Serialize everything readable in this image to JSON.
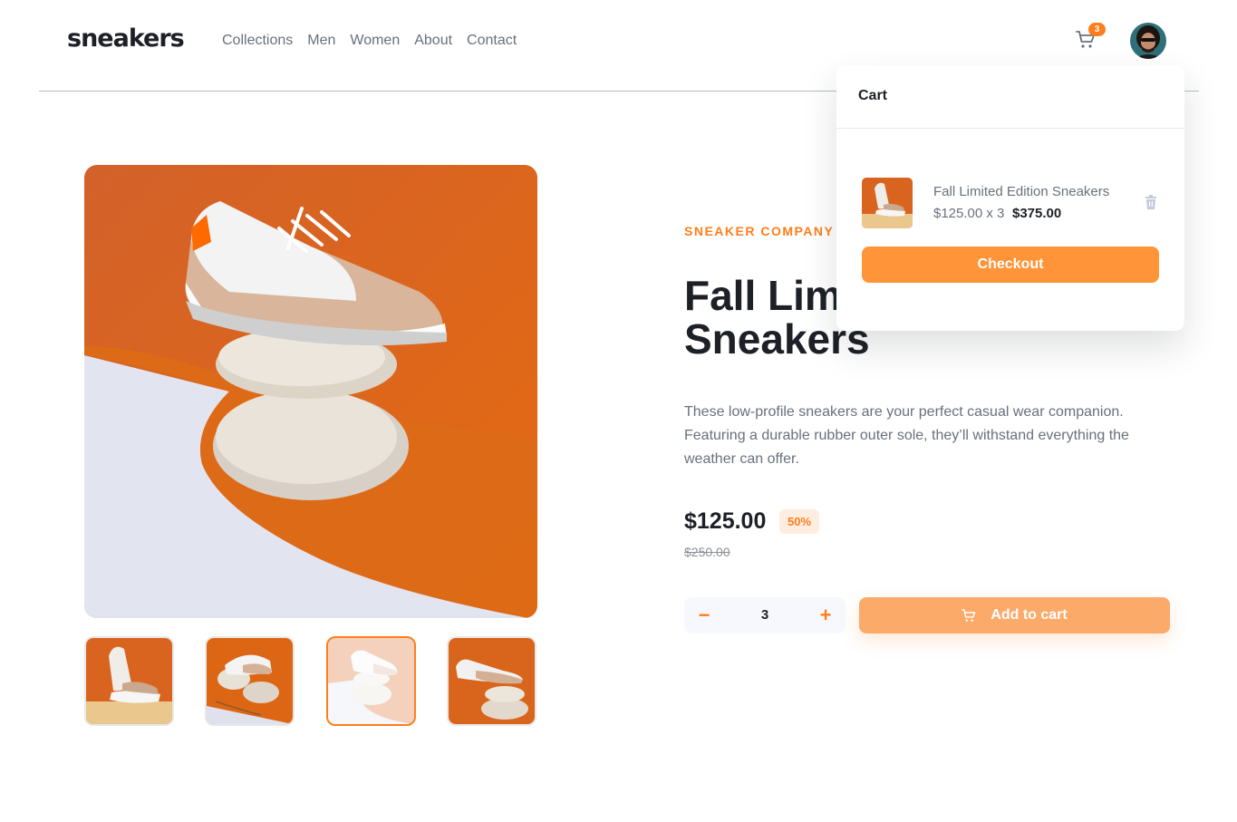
{
  "header": {
    "logo": "sneakers",
    "nav": [
      "Collections",
      "Men",
      "Women",
      "About",
      "Contact"
    ],
    "cart_count": "3"
  },
  "gallery": {
    "main_image": "white-beige-sneaker-on-stones",
    "thumbnails": [
      "sneaker-thumb-1",
      "sneaker-thumb-2",
      "sneaker-thumb-3",
      "sneaker-thumb-4"
    ],
    "active_thumbnail_index": 2
  },
  "product": {
    "company": "SNEAKER COMPANY",
    "title": "Fall Limited Edition Sneakers",
    "description": "These low-profile sneakers are your perfect casual wear companion. Featuring a durable rubber outer sole, they’ll withstand everything the weather can offer.",
    "price": "$125.00",
    "discount": "50%",
    "original_price": "$250.00",
    "quantity": "3",
    "quantity_minus": "−",
    "quantity_plus": "+",
    "add_to_cart": "Add to cart"
  },
  "cart": {
    "title": "Cart",
    "item_name": "Fall Limited Edition Sneakers",
    "item_calc": "$125.00 x 3",
    "item_total": "$375.00",
    "checkout": "Checkout"
  },
  "colors": {
    "accent": "#ff7e1b",
    "accent_pale": "#ffede0",
    "text_dark": "#1d2026",
    "text_muted": "#69707d"
  }
}
